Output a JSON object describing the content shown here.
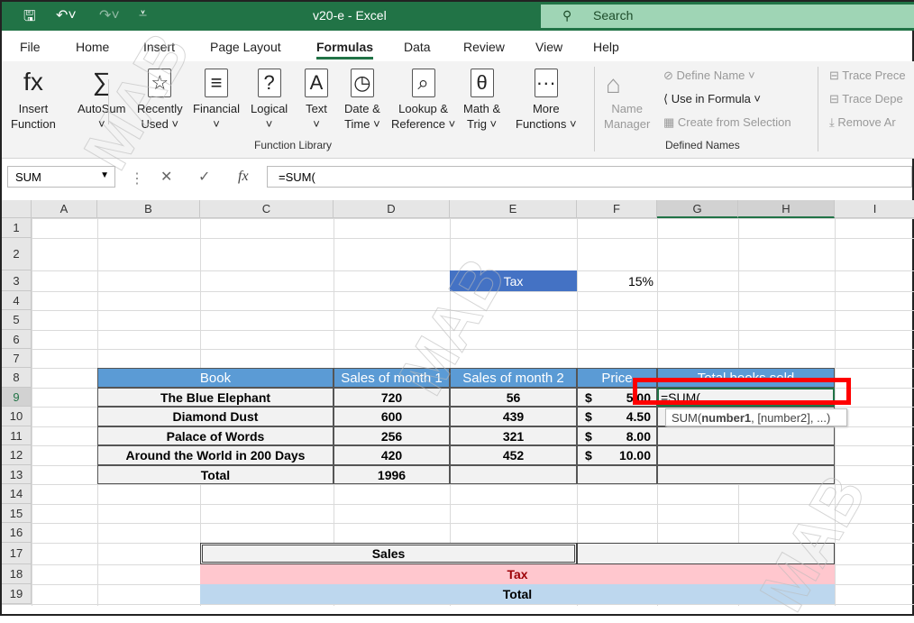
{
  "window": {
    "title": "v20-e  -  Excel",
    "search": "Search"
  },
  "menu": [
    "File",
    "Home",
    "Insert",
    "Page Layout",
    "Formulas",
    "Data",
    "Review",
    "View",
    "Help"
  ],
  "ribbon": {
    "function_library": [
      {
        "l1": "Insert",
        "l2": "Function",
        "icon": "fx"
      },
      {
        "l1": "AutoSum",
        "l2": "˅",
        "icon": "∑"
      },
      {
        "l1": "Recently",
        "l2": "Used ˅",
        "icon": "☆"
      },
      {
        "l1": "Financial",
        "l2": "˅",
        "icon": "≡"
      },
      {
        "l1": "Logical",
        "l2": "˅",
        "icon": "?"
      },
      {
        "l1": "Text",
        "l2": "˅",
        "icon": "A"
      },
      {
        "l1": "Date &",
        "l2": "Time ˅",
        "icon": "◷"
      },
      {
        "l1": "Lookup &",
        "l2": "Reference ˅",
        "icon": "⌕"
      },
      {
        "l1": "Math &",
        "l2": "Trig ˅",
        "icon": "θ"
      },
      {
        "l1": "More",
        "l2": "Functions ˅",
        "icon": "···"
      }
    ],
    "function_library_label": "Function Library",
    "name_manager": [
      "Name",
      "Manager"
    ],
    "define_name": "Define Name  ˅",
    "use_in_formula": "Use in Formula ˅",
    "create_from_selection": "Create from Selection",
    "defined_names_label": "Defined Names",
    "trace_precedents": "Trace Prece",
    "trace_dependents": "Trace Depe",
    "remove_arrows": "Remove Ar"
  },
  "formula_bar": {
    "name_box": "SUM",
    "formula": "=SUM("
  },
  "columns": [
    "A",
    "B",
    "C",
    "D",
    "E",
    "F",
    "G",
    "H",
    "I"
  ],
  "rows": [
    "1",
    "2",
    "3",
    "4",
    "5",
    "6",
    "7",
    "8",
    "9",
    "10",
    "11",
    "12",
    "13",
    "14",
    "15",
    "16",
    "17",
    "18",
    "19"
  ],
  "cells": {
    "tax_label": "Tax",
    "tax_value": "15%",
    "headers": [
      "Book",
      "Sales of month 1",
      "Sales of month 2",
      "Price",
      "Total books sold"
    ],
    "data": [
      {
        "book": "The Blue Elephant",
        "m1": "720",
        "m2": "56",
        "cur": "$",
        "price": "5.00"
      },
      {
        "book": "Diamond Dust",
        "m1": "600",
        "m2": "439",
        "cur": "$",
        "price": "4.50"
      },
      {
        "book": "Palace of Words",
        "m1": "256",
        "m2": "321",
        "cur": "$",
        "price": "8.00"
      },
      {
        "book": "Around the World in 200 Days",
        "m1": "420",
        "m2": "452",
        "cur": "$",
        "price": "10.00"
      }
    ],
    "total_label": "Total",
    "total_m1": "1996",
    "editing": "=SUM(",
    "tooltip_pre": "SUM(",
    "tooltip_bold": "number1",
    "tooltip_post": ", [number2], ...)",
    "sales": "Sales",
    "tax2": "Tax",
    "total2": "Total"
  },
  "watermark": "MAB",
  "colors": {
    "excel_green": "#217346",
    "header_blue": "#5b9bd5",
    "tax_blue": "#4472c4",
    "pink": "#ffc7ce",
    "light_blue": "#bdd7ee",
    "highlight_red": "#ff0000"
  }
}
